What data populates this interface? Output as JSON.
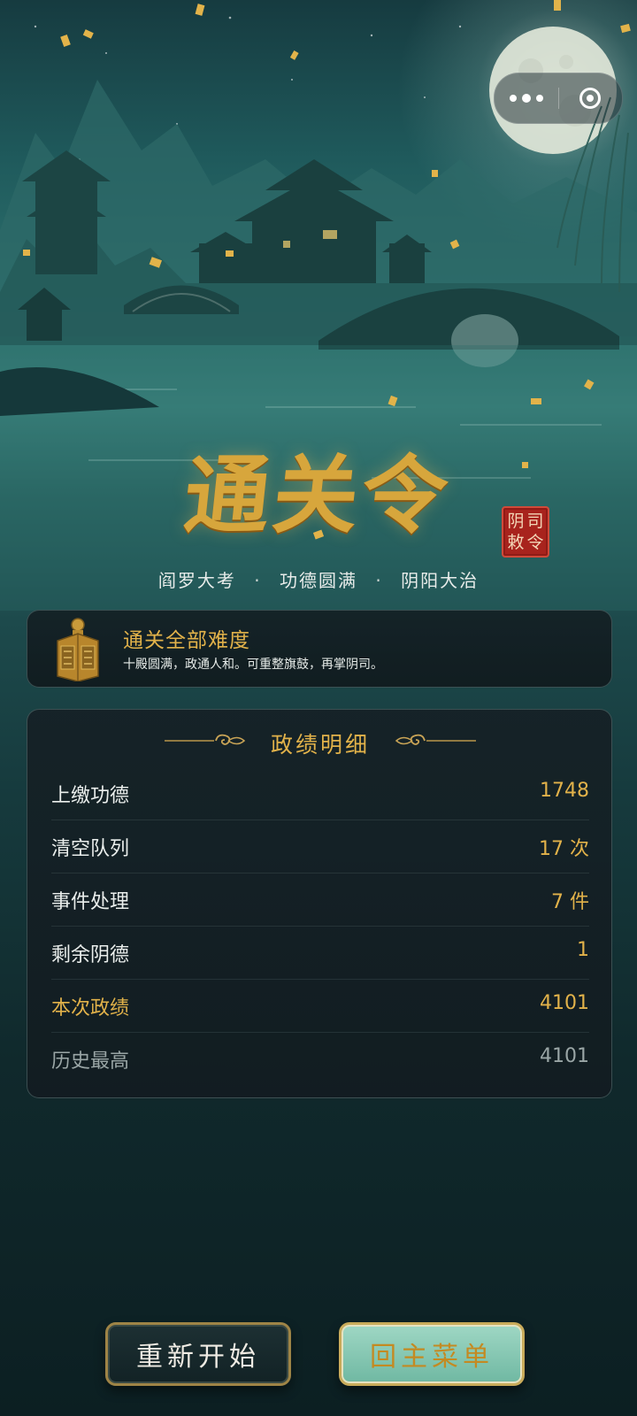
{
  "title": "通关令",
  "seal": [
    "阴",
    "司",
    "敕",
    "令"
  ],
  "subtitle": {
    "parts": [
      "阎罗大考",
      "功德圆满",
      "阴阳大治"
    ],
    "separator": "·"
  },
  "banner": {
    "title": "通关全部难度",
    "description": "十殿圆满，政通人和。可重整旗鼓，再掌阴司。"
  },
  "stats": {
    "title": "政绩明细",
    "rows": [
      {
        "label": "上缴功德",
        "value": "1748"
      },
      {
        "label": "清空队列",
        "value": "17 次"
      },
      {
        "label": "事件处理",
        "value": "7 件"
      },
      {
        "label": "剩余阴德",
        "value": "1"
      },
      {
        "label": "本次政绩",
        "value": "4101"
      },
      {
        "label": "历史最高",
        "value": "4101"
      }
    ]
  },
  "buttons": {
    "restart": "重新开始",
    "menu": "回主菜单"
  },
  "colors": {
    "gold": "#e2b24a",
    "panel": "#16212a",
    "seal_red": "#a8231d",
    "menu_button": "#8fcdb8"
  },
  "icons": {
    "more": "more-dots-icon",
    "close": "close-circle-icon",
    "lantern": "lantern-icon"
  }
}
